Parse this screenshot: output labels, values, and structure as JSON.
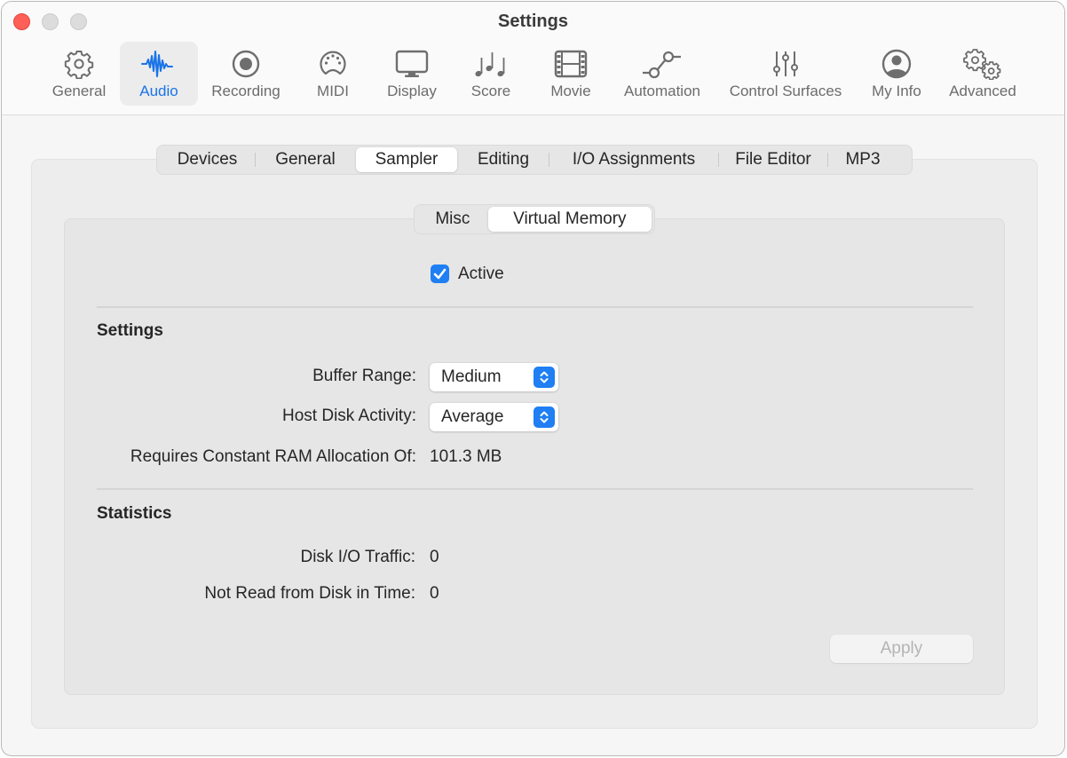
{
  "window": {
    "title": "Settings",
    "controls": [
      "close",
      "minimize",
      "zoom"
    ]
  },
  "toolbar": {
    "selected": "Audio",
    "items": [
      {
        "label": "General",
        "icon": "gear-icon"
      },
      {
        "label": "Audio",
        "icon": "waveform-icon"
      },
      {
        "label": "Recording",
        "icon": "record-icon"
      },
      {
        "label": "MIDI",
        "icon": "midi-connector-icon"
      },
      {
        "label": "Display",
        "icon": "display-icon"
      },
      {
        "label": "Score",
        "icon": "music-notes-icon"
      },
      {
        "label": "Movie",
        "icon": "film-icon"
      },
      {
        "label": "Automation",
        "icon": "automation-curve-icon"
      },
      {
        "label": "Control Surfaces",
        "icon": "sliders-icon"
      },
      {
        "label": "My Info",
        "icon": "person-circle-icon"
      },
      {
        "label": "Advanced",
        "icon": "gears-icon"
      }
    ]
  },
  "tabs": {
    "selected": "Sampler",
    "items": [
      "Devices",
      "General",
      "Sampler",
      "Editing",
      "I/O Assignments",
      "File Editor",
      "MP3"
    ]
  },
  "subtabs": {
    "selected": "Virtual Memory",
    "items": [
      "Misc",
      "Virtual Memory"
    ]
  },
  "active": {
    "label": "Active",
    "checked": true
  },
  "settings": {
    "heading": "Settings",
    "buffer_range": {
      "label": "Buffer Range:",
      "value": "Medium"
    },
    "host_disk_activity": {
      "label": "Host Disk Activity:",
      "value": "Average"
    },
    "ram_allocation": {
      "label": "Requires Constant RAM Allocation Of:",
      "value": "101.3 MB"
    }
  },
  "statistics": {
    "heading": "Statistics",
    "disk_io_traffic": {
      "label": "Disk I/O Traffic:",
      "value": "0"
    },
    "not_read_in_time": {
      "label": "Not Read from Disk in Time:",
      "value": "0"
    }
  },
  "apply_button": {
    "label": "Apply",
    "enabled": false
  },
  "colors": {
    "accent": "#1f7ff3",
    "selected_toolbar_text": "#1a73e8",
    "close_button": "#fe5f57"
  }
}
